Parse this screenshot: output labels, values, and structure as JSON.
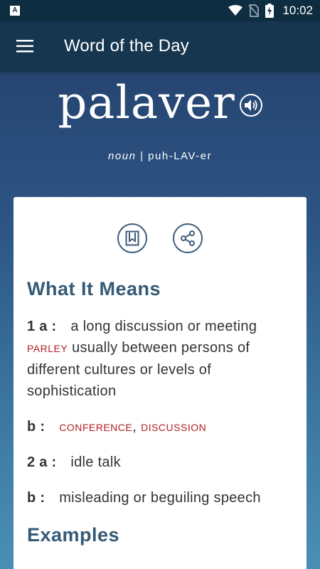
{
  "status_bar": {
    "time": "10:02",
    "notification_letter": "A",
    "icons": [
      "wifi-icon",
      "no-sim-icon",
      "battery-charging-icon"
    ]
  },
  "app_bar": {
    "title": "Word of the Day"
  },
  "word": {
    "headword": "palaver",
    "part_of_speech": "noun",
    "separator": "|",
    "pronunciation": "puh-LAV-er"
  },
  "card": {
    "icons": [
      "bookmark-icon",
      "share-icon"
    ],
    "meaning_heading": "What It Means",
    "definitions": [
      {
        "num": "1 a :",
        "text": "a long discussion or meeting",
        "xref": "parley",
        "text2": "usually between persons of different cultures or levels of sophistication"
      },
      {
        "num": "b :",
        "xref1": "conference",
        "comma": ",",
        "xref2": "discussion"
      },
      {
        "num": "2 a :",
        "text": "idle talk"
      },
      {
        "num": "b :",
        "text": "misleading or beguiling speech"
      }
    ],
    "examples_heading": "Examples"
  },
  "colors": {
    "status_bar": "#0f2d40",
    "app_bar": "#16364f",
    "heading": "#355a76",
    "xref": "#b01f24"
  }
}
